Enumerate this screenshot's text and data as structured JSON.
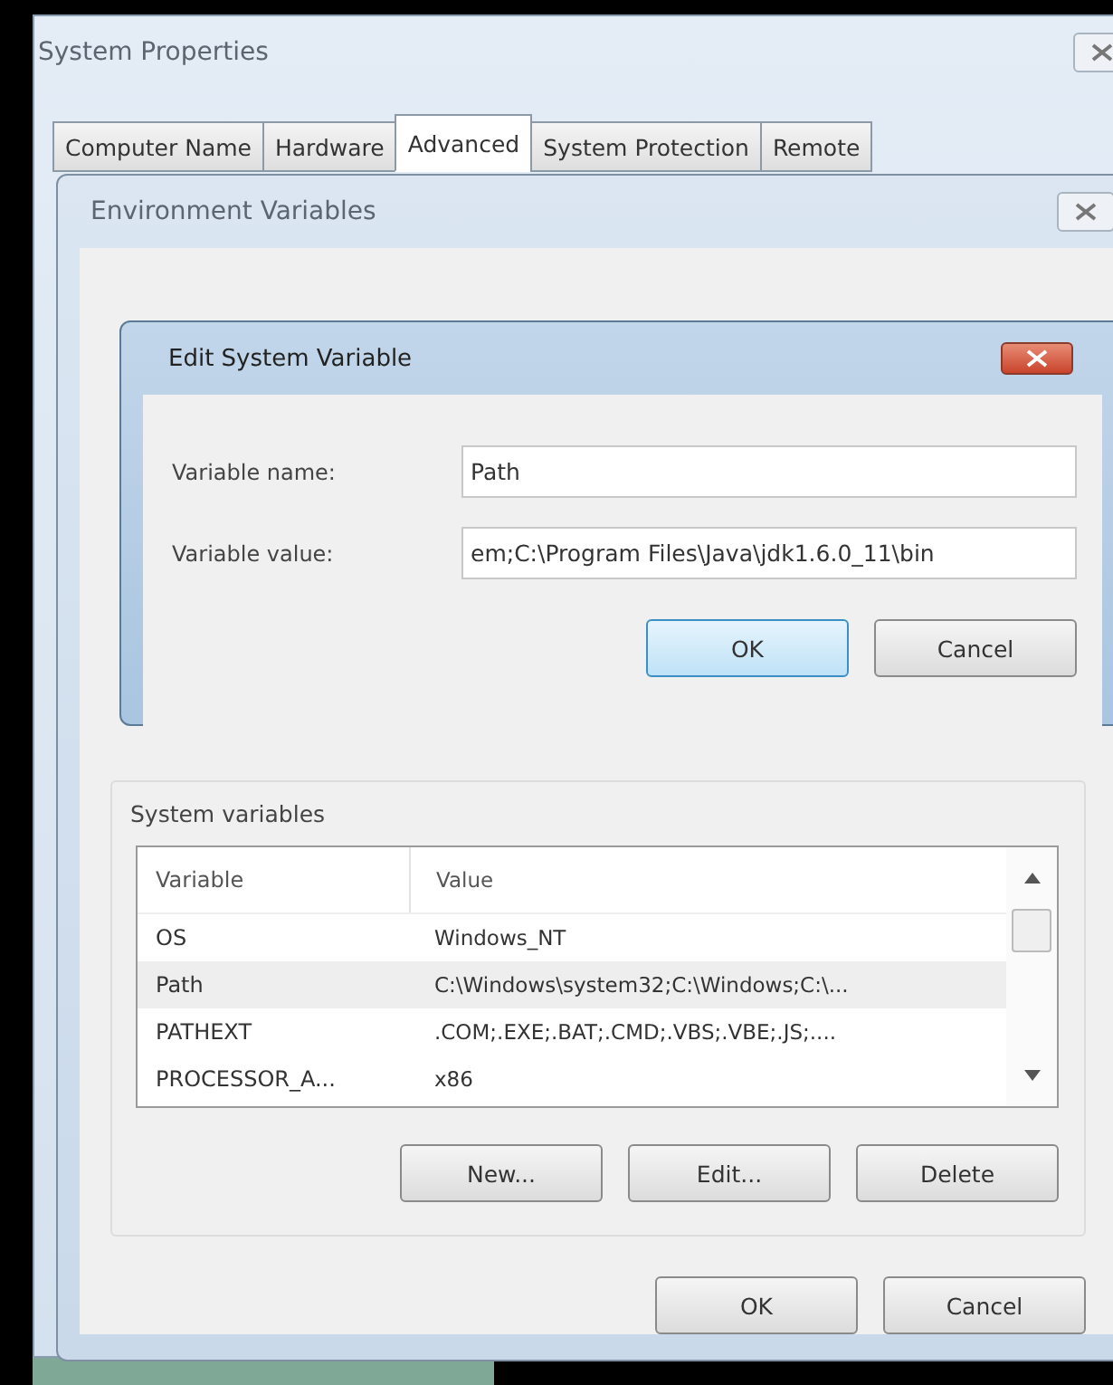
{
  "system_properties": {
    "title": "System Properties",
    "tabs": [
      {
        "label": "Computer Name",
        "selected": false
      },
      {
        "label": "Hardware",
        "selected": false
      },
      {
        "label": "Advanced",
        "selected": true
      },
      {
        "label": "System Protection",
        "selected": false
      },
      {
        "label": "Remote",
        "selected": false
      }
    ]
  },
  "environment_variables": {
    "title": "Environment Variables",
    "system_variables": {
      "label": "System variables",
      "columns": [
        "Variable",
        "Value"
      ],
      "rows": [
        {
          "variable": "OS",
          "value": "Windows_NT",
          "selected": false
        },
        {
          "variable": "Path",
          "value": "C:\\Windows\\system32;C:\\Windows;C:\\...",
          "selected": true
        },
        {
          "variable": "PATHEXT",
          "value": ".COM;.EXE;.BAT;.CMD;.VBS;.VBE;.JS;....",
          "selected": false
        },
        {
          "variable": "PROCESSOR_A...",
          "value": "x86",
          "selected": false
        }
      ],
      "buttons": [
        "New...",
        "Edit...",
        "Delete"
      ]
    },
    "buttons": [
      "OK",
      "Cancel"
    ]
  },
  "edit_dialog": {
    "title": "Edit System Variable",
    "fields": [
      {
        "label": "Variable name:",
        "value": "Path"
      },
      {
        "label": "Variable value:",
        "value": "em;C:\\Program Files\\Java\\jdk1.6.0_11\\bin"
      }
    ],
    "buttons": [
      {
        "label": "OK",
        "default": true
      },
      {
        "label": "Cancel",
        "default": false
      }
    ]
  }
}
